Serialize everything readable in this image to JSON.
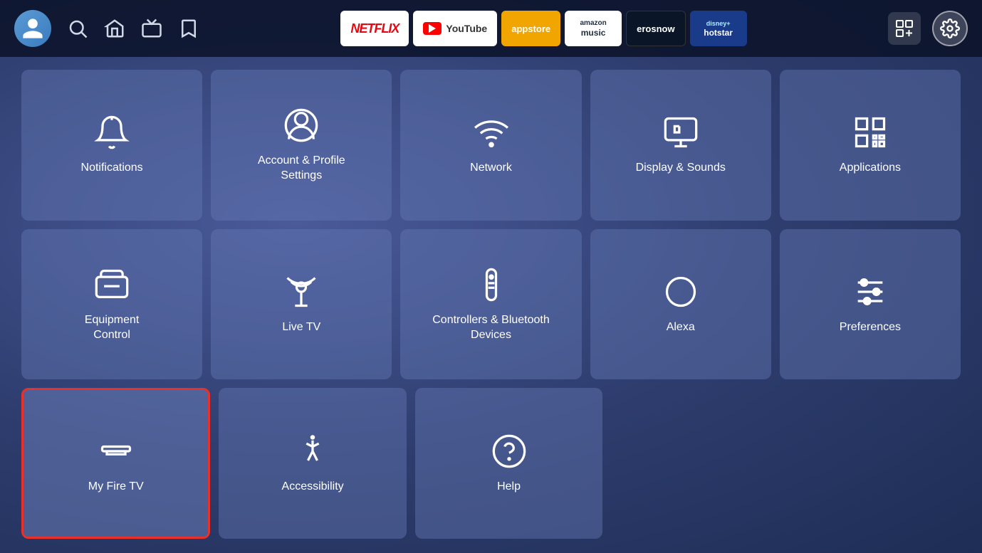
{
  "topbar": {
    "apps": [
      {
        "id": "netflix",
        "label": "NETFLIX",
        "type": "netflix"
      },
      {
        "id": "youtube",
        "label": "YouTube",
        "type": "youtube"
      },
      {
        "id": "appstore",
        "label": "appstore",
        "type": "appstore"
      },
      {
        "id": "amazon-music",
        "label": "amazon music",
        "type": "amazon-music"
      },
      {
        "id": "erosnow",
        "label": "erosnow",
        "type": "erosnow"
      },
      {
        "id": "hotstar",
        "label": "disney+ hotstar",
        "type": "hotstar"
      }
    ],
    "icons": {
      "grid_plus": "⊞",
      "settings": "⚙"
    }
  },
  "settings": {
    "rows": [
      [
        {
          "id": "notifications",
          "label": "Notifications",
          "icon": "bell"
        },
        {
          "id": "account-profile",
          "label": "Account & Profile\nSettings",
          "icon": "user"
        },
        {
          "id": "network",
          "label": "Network",
          "icon": "wifi"
        },
        {
          "id": "display-sounds",
          "label": "Display & Sounds",
          "icon": "monitor"
        },
        {
          "id": "applications",
          "label": "Applications",
          "icon": "apps"
        }
      ],
      [
        {
          "id": "equipment-control",
          "label": "Equipment\nControl",
          "icon": "tv"
        },
        {
          "id": "live-tv",
          "label": "Live TV",
          "icon": "antenna"
        },
        {
          "id": "controllers-bluetooth",
          "label": "Controllers & Bluetooth\nDevices",
          "icon": "remote"
        },
        {
          "id": "alexa",
          "label": "Alexa",
          "icon": "alexa"
        },
        {
          "id": "preferences",
          "label": "Preferences",
          "icon": "sliders"
        }
      ],
      [
        {
          "id": "my-fire-tv",
          "label": "My Fire TV",
          "icon": "firetv",
          "selected": true
        },
        {
          "id": "accessibility",
          "label": "Accessibility",
          "icon": "accessibility"
        },
        {
          "id": "help",
          "label": "Help",
          "icon": "help"
        },
        {
          "id": "empty1",
          "label": "",
          "icon": "empty"
        },
        {
          "id": "empty2",
          "label": "",
          "icon": "empty"
        }
      ]
    ]
  }
}
